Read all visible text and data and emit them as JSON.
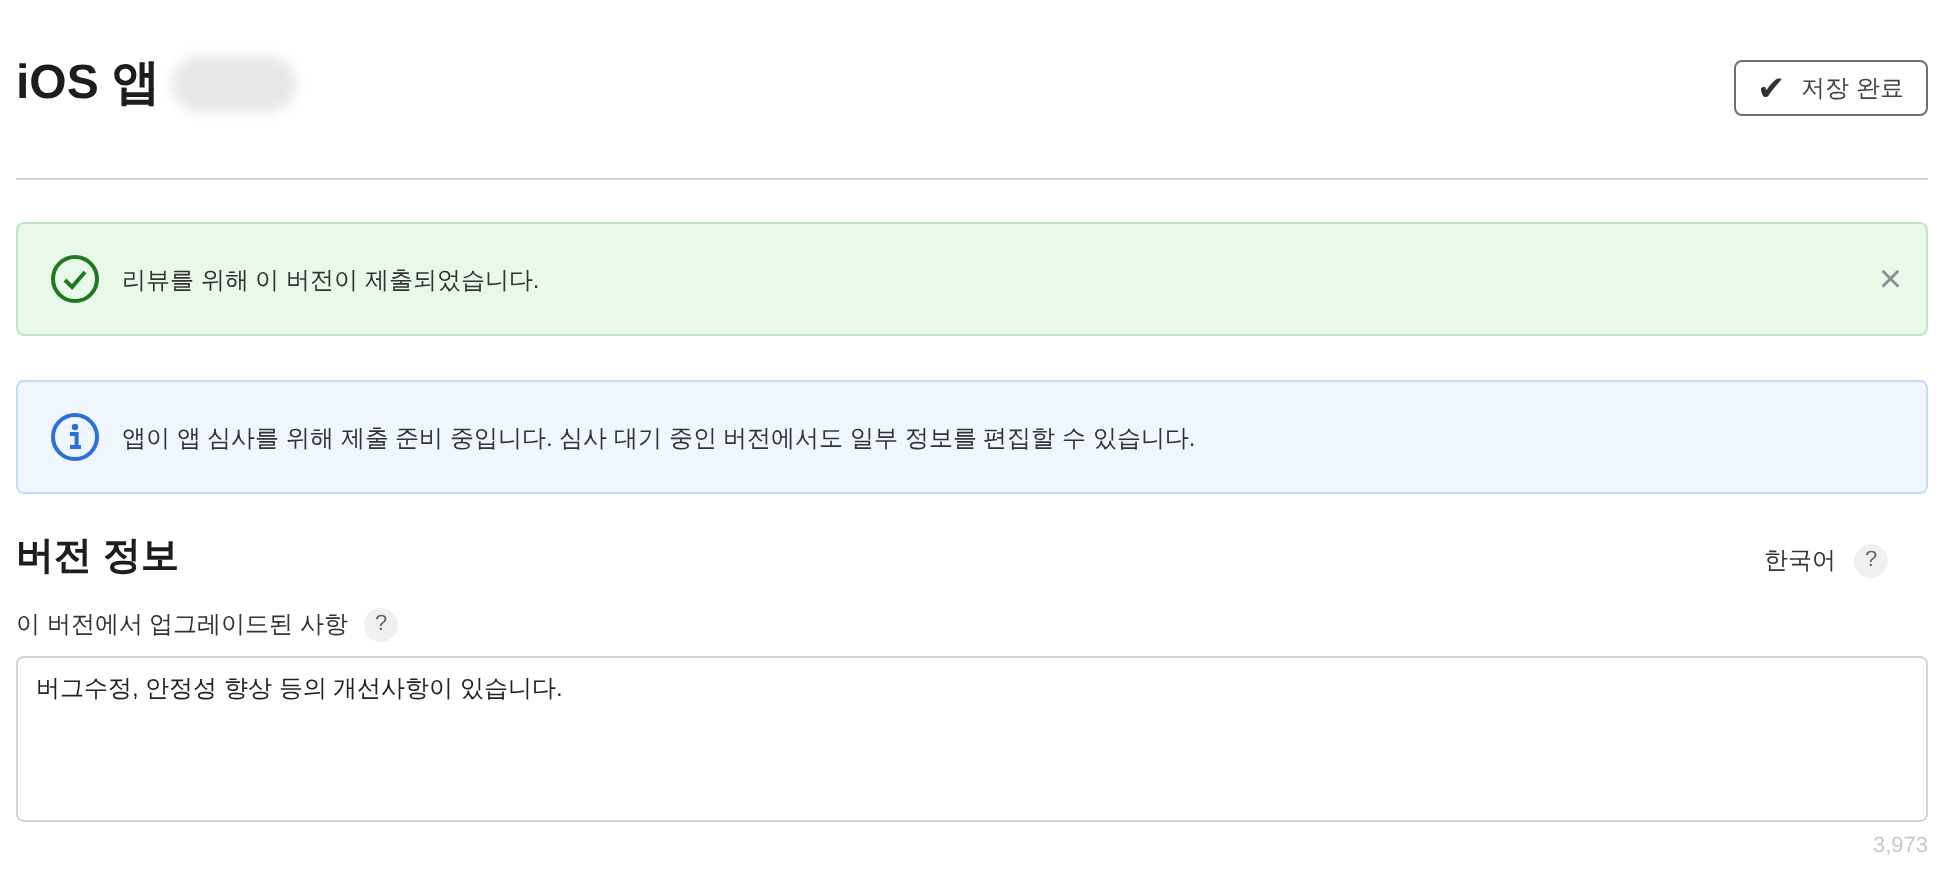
{
  "header": {
    "title": "iOS 앱",
    "title_redacted": true,
    "save_button": {
      "label": "저장 완료",
      "icon": "✔"
    }
  },
  "alerts": [
    {
      "kind": "success",
      "message": "리뷰를 위해 이 버전이 제출되었습니다.",
      "dismiss": "×"
    },
    {
      "kind": "info",
      "message": "앱이 앱 심사를 위해 제출 준비 중입니다. 심사 대기 중인 버전에서도 일부 정보를 편집할 수 있습니다."
    }
  ],
  "section": {
    "title": "버전 정보",
    "language": "한국어",
    "language_help": "?",
    "field": {
      "label": "이 버전에서 업그레이드된 사항",
      "help": "?",
      "value": "버그수정, 안정성 향상 등의 개선사항이 있습니다.",
      "counter": "3,973"
    }
  }
}
